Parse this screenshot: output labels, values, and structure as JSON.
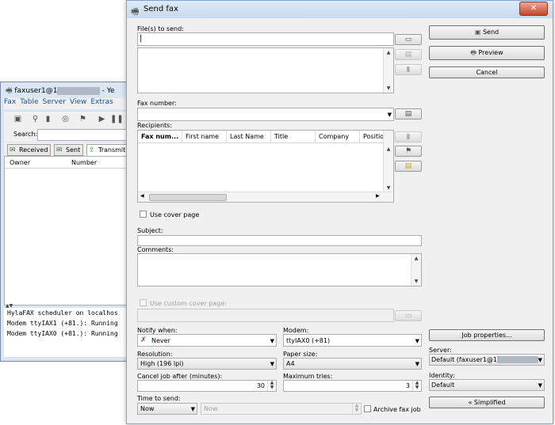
{
  "background_window": {
    "title": "faxuser1@1",
    "title_tail": " - Ye",
    "menu": [
      "Fax",
      "Table",
      "Server",
      "View",
      "Extras"
    ],
    "search_label": "Search:",
    "tabs": [
      "Received",
      "Sent",
      "Transmit"
    ],
    "columns": [
      "Owner",
      "Number"
    ],
    "log_lines": [
      "HylaFAX scheduler on localhos",
      "Modem ttyIAX1 (+81.): Running",
      "Modem ttyIAX0 (+81.): Running"
    ]
  },
  "dialog": {
    "title": "Send fax",
    "close_glyph": "✕",
    "files_label": "File(s) to send:",
    "fax_number_label": "Fax number:",
    "recipients_label": "Recipients:",
    "recipient_columns": [
      "Fax num...",
      "First name",
      "Last Name",
      "Title",
      "Company",
      "Positio"
    ],
    "use_cover_page_label": "Use cover page",
    "subject_label": "Subject:",
    "comments_label": "Comments:",
    "use_custom_cover_label": "Use custom cover page:",
    "notify_when_label": "Notify when:",
    "notify_when_value": "Never",
    "modem_label": "Modem:",
    "modem_value": "ttyIAX0 (+81)",
    "resolution_label": "Resolution:",
    "resolution_value": "High (196 lpi)",
    "paper_size_label": "Paper size:",
    "paper_size_value": "A4",
    "cancel_after_label": "Cancel job after (minutes):",
    "cancel_after_value": "30",
    "max_tries_label": "Maximum tries:",
    "max_tries_value": "3",
    "time_to_send_label": "Time to send:",
    "time_to_send_value": "Now",
    "time_field_value": "Now",
    "archive_label": "Archive fax job",
    "buttons": {
      "send": "Send",
      "preview": "Preview",
      "cancel": "Cancel",
      "job_properties": "Job properties...",
      "simplified": "Simplified"
    },
    "server_label": "Server:",
    "server_value": "Default (faxuser1@1",
    "identity_label": "Identity:",
    "identity_value": "Default"
  }
}
